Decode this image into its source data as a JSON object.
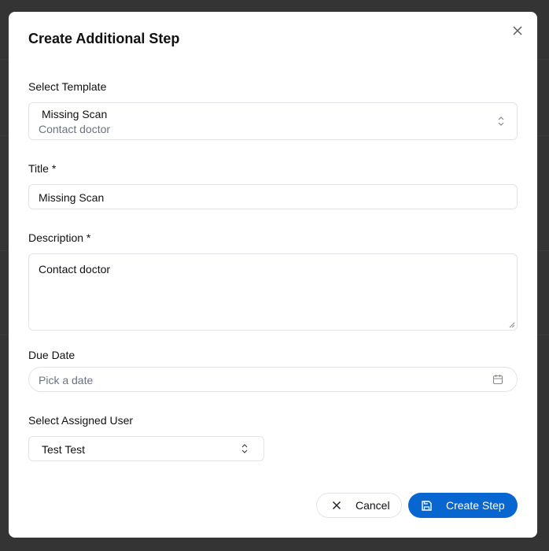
{
  "dialog": {
    "title": "Create Additional Step"
  },
  "template": {
    "label": "Select Template",
    "selected_title": "Missing Scan",
    "selected_description": "Contact doctor"
  },
  "title_field": {
    "label": "Title *",
    "value": "Missing Scan"
  },
  "description_field": {
    "label": "Description *",
    "value": "Contact doctor"
  },
  "due_date": {
    "label": "Due Date",
    "placeholder": "Pick a date"
  },
  "assigned_user": {
    "label": "Select Assigned User",
    "selected": "Test Test"
  },
  "actions": {
    "cancel": "Cancel",
    "create": "Create Step"
  },
  "colors": {
    "primary": "#0866d0",
    "overlay": "#333433"
  }
}
